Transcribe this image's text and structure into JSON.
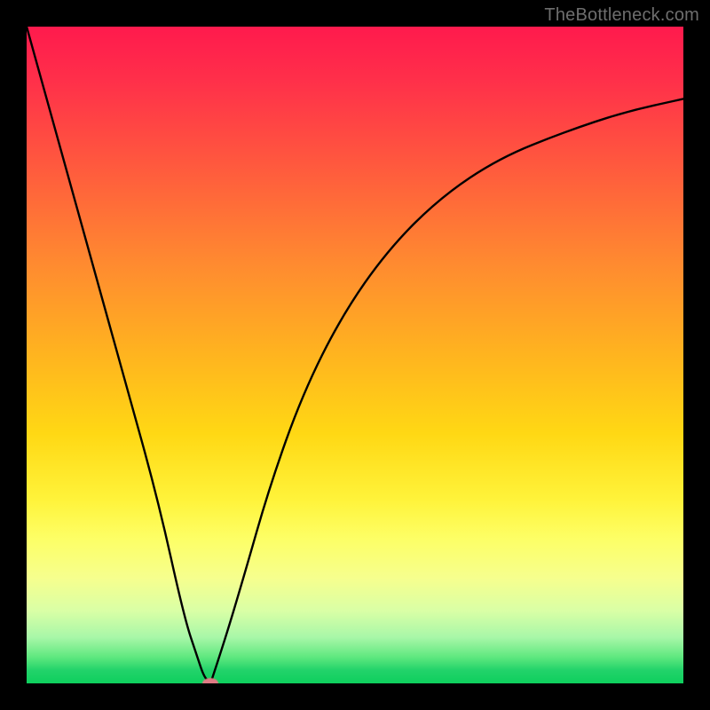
{
  "watermark": {
    "text": "TheBottleneck.com"
  },
  "chart_data": {
    "type": "line",
    "title": "",
    "xlabel": "",
    "ylabel": "",
    "xlim": [
      0,
      100
    ],
    "ylim": [
      0,
      100
    ],
    "grid": false,
    "legend": false,
    "curve_left": {
      "description": "descending segment from top-left to minimum",
      "x": [
        0,
        5,
        10,
        15,
        20,
        24,
        26,
        27,
        28
      ],
      "y": [
        100,
        82,
        64,
        46,
        28,
        10,
        4,
        1,
        0
      ]
    },
    "curve_right": {
      "description": "ascending segment from minimum toward upper-right, asymptotic",
      "x": [
        28,
        30,
        33,
        37,
        42,
        48,
        55,
        63,
        72,
        82,
        91,
        100
      ],
      "y": [
        0,
        6,
        16,
        30,
        44,
        56,
        66,
        74,
        80,
        84,
        87,
        89
      ]
    },
    "minimum_point": {
      "x": 28,
      "y": 0
    },
    "background_gradient_axis": "y",
    "background_gradient_meaning": "high y = red (bad), low y = green (good)",
    "colors": {
      "curve": "#000000",
      "min_marker": "#e07a84",
      "frame": "#000000",
      "gradient_stops": [
        {
          "pos": 0.0,
          "hex": "#ff1a4d"
        },
        {
          "pos": 0.5,
          "hex": "#ffb41f"
        },
        {
          "pos": 0.78,
          "hex": "#fdff66"
        },
        {
          "pos": 1.0,
          "hex": "#0ecf5d"
        }
      ]
    }
  }
}
